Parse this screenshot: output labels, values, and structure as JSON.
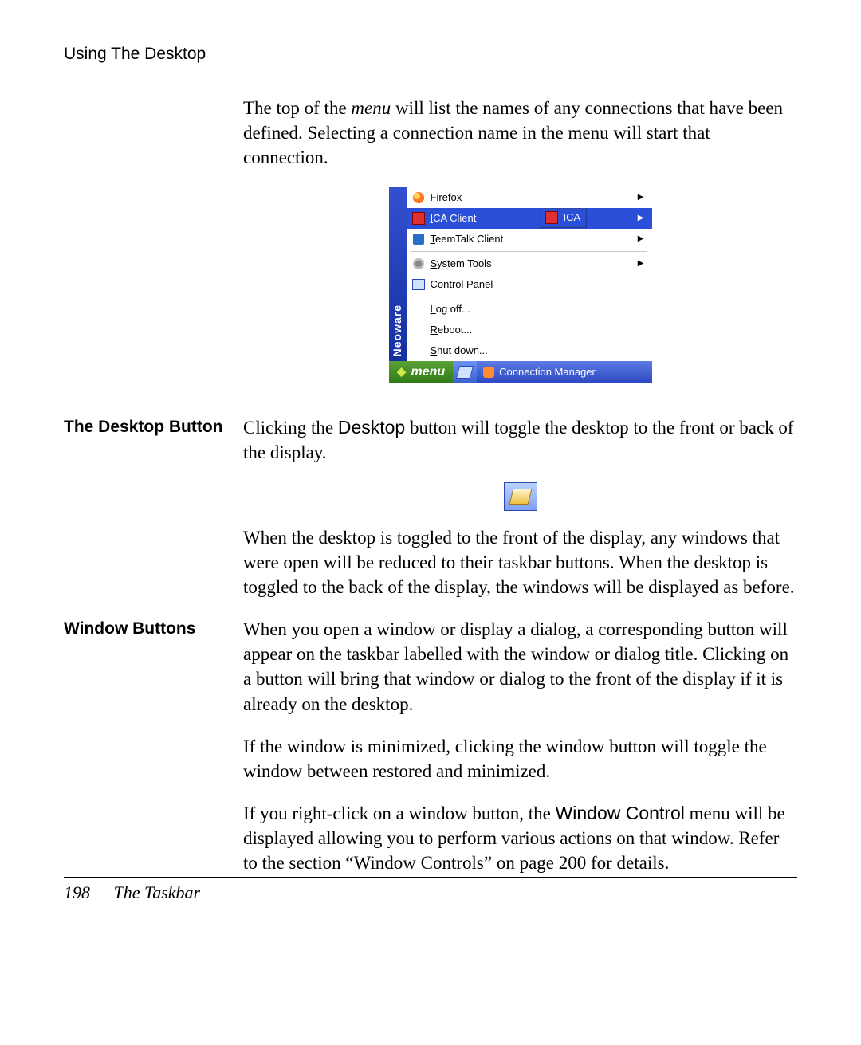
{
  "header": {
    "title": "Using The Desktop"
  },
  "intro": {
    "p1_a": "The top of the ",
    "p1_menu": "menu",
    "p1_b": " will list the names of any connections that have been defined. Selecting a connection name in the menu will start that connection."
  },
  "menu": {
    "brand": "Neoware",
    "items": {
      "firefox": {
        "label": "Firefox",
        "accel": "F",
        "arrow": true,
        "icon": "firefox-icon"
      },
      "ica": {
        "label": "ICA Client",
        "accel": "I",
        "arrow": true,
        "icon": "app-icon",
        "highlight": true
      },
      "teemtalk": {
        "label": "TeemTalk Client",
        "accel": "T",
        "arrow": true,
        "icon": "term-icon"
      },
      "systools": {
        "label": "System Tools",
        "accel": "S",
        "arrow": true,
        "icon": "gear-icon"
      },
      "cpanel": {
        "label": "Control Panel",
        "accel": "C",
        "arrow": false,
        "icon": "control-panel-icon"
      },
      "logoff": {
        "label": "Log off...",
        "accel": "L"
      },
      "reboot": {
        "label": "Reboot...",
        "accel": "R"
      },
      "shutdown": {
        "label": "Shut down...",
        "accel": "S"
      }
    },
    "submenu": {
      "ica": {
        "label": "ICA",
        "accel": "I",
        "icon": "app-icon"
      }
    }
  },
  "taskbar": {
    "menu_label": "menu",
    "connection_manager": "Connection Manager"
  },
  "sections": {
    "desktop_button": {
      "heading": "The Desktop Button",
      "p1_a": "Clicking the ",
      "p1_desktop": "Desktop",
      "p1_b": " button will toggle the desktop to the front or back of the display.",
      "p2": "When the desktop is toggled to the front of the display, any windows that were open will be reduced to their taskbar buttons. When the desktop is toggled to the back of the display, the windows will be displayed as before."
    },
    "window_buttons": {
      "heading": "Window Buttons",
      "p1": "When you open a window or display a dialog, a corresponding button will appear on the taskbar labelled with the window or dialog title. Clicking on a button will bring that window or dialog to the front of the display if it is already on the desktop.",
      "p2": "If the window is minimized, clicking the window button will toggle the window between restored and minimized.",
      "p3_a": "If you right-click on a window button, the ",
      "p3_wc": "Window Control",
      "p3_b": " menu will be displayed allowing you to perform various actions on that window. Refer to the section “Window Controls” on page 200 for details."
    }
  },
  "footer": {
    "page_number": "198",
    "section": "The Taskbar"
  }
}
